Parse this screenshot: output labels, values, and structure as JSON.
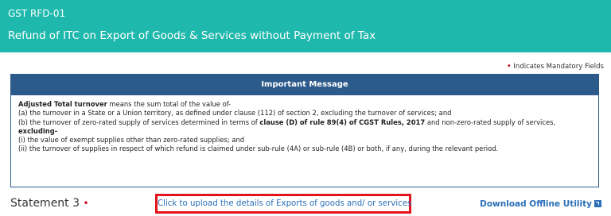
{
  "header": {
    "form_code": "GST RFD-01",
    "title": "Refund of ITC on Export of Goods & Services without Payment of Tax"
  },
  "mandatory_note": {
    "star": "•",
    "text": "Indicates Mandatory Fields"
  },
  "important_message": {
    "heading": "Important Message",
    "term": "Adjusted Total turnover",
    "intro_rest": " means the sum total of the value of-",
    "line_a": "(a) the turnover in a State or a Union territory, as defined under clause (112) of section 2, excluding the turnover of services; and",
    "line_b_start": "(b) the turnover of zero-rated supply of services determined in terms of ",
    "line_b_bold": "clause (D) of rule 89(4) of CGST Rules, 2017",
    "line_b_end": " and non-zero-rated supply of services,",
    "excluding": "excluding-",
    "line_i": "(i) the value of exempt supplies other than zero-rated supplies; and",
    "line_ii": "(ii) the turnover of supplies in respect of which refund is claimed under sub-rule (4A) or sub-rule (4B) or both, if any, during the relevant period."
  },
  "statement": {
    "label": "Statement 3",
    "star": "•"
  },
  "upload_link": "Click to upload the details of Exports of goods and/ or services",
  "download_link": "Download Offline Utility",
  "colors": {
    "header_bg": "#1fb8ac",
    "message_header_bg": "#2c5a8a",
    "link": "#2a6fb8",
    "highlight_border": "#e2131b",
    "required_star": "#d0021b"
  },
  "icons": {
    "download_icon": "external-link-icon"
  }
}
